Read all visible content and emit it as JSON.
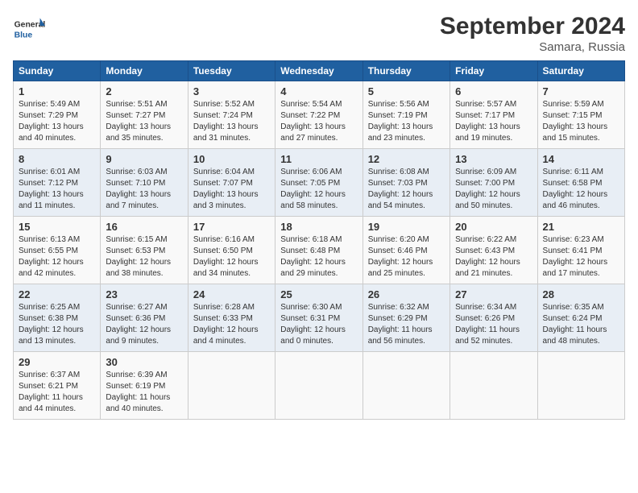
{
  "header": {
    "logo_general": "General",
    "logo_blue": "Blue",
    "month_title": "September 2024",
    "location": "Samara, Russia"
  },
  "columns": [
    "Sunday",
    "Monday",
    "Tuesday",
    "Wednesday",
    "Thursday",
    "Friday",
    "Saturday"
  ],
  "weeks": [
    [
      {
        "day": "1",
        "rise": "5:49 AM",
        "set": "7:29 PM",
        "daylight": "13 hours and 40 minutes."
      },
      {
        "day": "2",
        "rise": "5:51 AM",
        "set": "7:27 PM",
        "daylight": "13 hours and 35 minutes."
      },
      {
        "day": "3",
        "rise": "5:52 AM",
        "set": "7:24 PM",
        "daylight": "13 hours and 31 minutes."
      },
      {
        "day": "4",
        "rise": "5:54 AM",
        "set": "7:22 PM",
        "daylight": "13 hours and 27 minutes."
      },
      {
        "day": "5",
        "rise": "5:56 AM",
        "set": "7:19 PM",
        "daylight": "13 hours and 23 minutes."
      },
      {
        "day": "6",
        "rise": "5:57 AM",
        "set": "7:17 PM",
        "daylight": "13 hours and 19 minutes."
      },
      {
        "day": "7",
        "rise": "5:59 AM",
        "set": "7:15 PM",
        "daylight": "13 hours and 15 minutes."
      }
    ],
    [
      {
        "day": "8",
        "rise": "6:01 AM",
        "set": "7:12 PM",
        "daylight": "13 hours and 11 minutes."
      },
      {
        "day": "9",
        "rise": "6:03 AM",
        "set": "7:10 PM",
        "daylight": "13 hours and 7 minutes."
      },
      {
        "day": "10",
        "rise": "6:04 AM",
        "set": "7:07 PM",
        "daylight": "13 hours and 3 minutes."
      },
      {
        "day": "11",
        "rise": "6:06 AM",
        "set": "7:05 PM",
        "daylight": "12 hours and 58 minutes."
      },
      {
        "day": "12",
        "rise": "6:08 AM",
        "set": "7:03 PM",
        "daylight": "12 hours and 54 minutes."
      },
      {
        "day": "13",
        "rise": "6:09 AM",
        "set": "7:00 PM",
        "daylight": "12 hours and 50 minutes."
      },
      {
        "day": "14",
        "rise": "6:11 AM",
        "set": "6:58 PM",
        "daylight": "12 hours and 46 minutes."
      }
    ],
    [
      {
        "day": "15",
        "rise": "6:13 AM",
        "set": "6:55 PM",
        "daylight": "12 hours and 42 minutes."
      },
      {
        "day": "16",
        "rise": "6:15 AM",
        "set": "6:53 PM",
        "daylight": "12 hours and 38 minutes."
      },
      {
        "day": "17",
        "rise": "6:16 AM",
        "set": "6:50 PM",
        "daylight": "12 hours and 34 minutes."
      },
      {
        "day": "18",
        "rise": "6:18 AM",
        "set": "6:48 PM",
        "daylight": "12 hours and 29 minutes."
      },
      {
        "day": "19",
        "rise": "6:20 AM",
        "set": "6:46 PM",
        "daylight": "12 hours and 25 minutes."
      },
      {
        "day": "20",
        "rise": "6:22 AM",
        "set": "6:43 PM",
        "daylight": "12 hours and 21 minutes."
      },
      {
        "day": "21",
        "rise": "6:23 AM",
        "set": "6:41 PM",
        "daylight": "12 hours and 17 minutes."
      }
    ],
    [
      {
        "day": "22",
        "rise": "6:25 AM",
        "set": "6:38 PM",
        "daylight": "12 hours and 13 minutes."
      },
      {
        "day": "23",
        "rise": "6:27 AM",
        "set": "6:36 PM",
        "daylight": "12 hours and 9 minutes."
      },
      {
        "day": "24",
        "rise": "6:28 AM",
        "set": "6:33 PM",
        "daylight": "12 hours and 4 minutes."
      },
      {
        "day": "25",
        "rise": "6:30 AM",
        "set": "6:31 PM",
        "daylight": "12 hours and 0 minutes."
      },
      {
        "day": "26",
        "rise": "6:32 AM",
        "set": "6:29 PM",
        "daylight": "11 hours and 56 minutes."
      },
      {
        "day": "27",
        "rise": "6:34 AM",
        "set": "6:26 PM",
        "daylight": "11 hours and 52 minutes."
      },
      {
        "day": "28",
        "rise": "6:35 AM",
        "set": "6:24 PM",
        "daylight": "11 hours and 48 minutes."
      }
    ],
    [
      {
        "day": "29",
        "rise": "6:37 AM",
        "set": "6:21 PM",
        "daylight": "11 hours and 44 minutes."
      },
      {
        "day": "30",
        "rise": "6:39 AM",
        "set": "6:19 PM",
        "daylight": "11 hours and 40 minutes."
      },
      null,
      null,
      null,
      null,
      null
    ]
  ]
}
